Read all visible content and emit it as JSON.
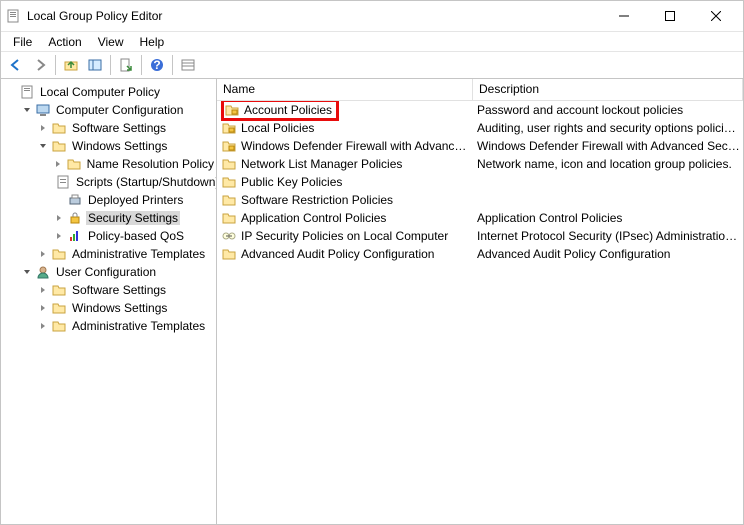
{
  "window": {
    "title": "Local Group Policy Editor"
  },
  "menu": {
    "file": "File",
    "action": "Action",
    "view": "View",
    "help": "Help"
  },
  "tree": {
    "root": "Local Computer Policy",
    "cc": "Computer Configuration",
    "cc_sw": "Software Settings",
    "cc_ws": "Windows Settings",
    "cc_ws_nrp": "Name Resolution Policy",
    "cc_ws_scripts": "Scripts (Startup/Shutdown)",
    "cc_ws_dp": "Deployed Printers",
    "cc_ws_ss": "Security Settings",
    "cc_ws_qos": "Policy-based QoS",
    "cc_at": "Administrative Templates",
    "uc": "User Configuration",
    "uc_sw": "Software Settings",
    "uc_ws": "Windows Settings",
    "uc_at": "Administrative Templates"
  },
  "columns": {
    "name": "Name",
    "description": "Description"
  },
  "rows": {
    "r0": {
      "name": "Account Policies",
      "desc": "Password and account lockout policies"
    },
    "r1": {
      "name": "Local Policies",
      "desc": "Auditing, user rights and security options polici…"
    },
    "r2": {
      "name": "Windows Defender Firewall with Advanc…",
      "desc": "Windows Defender Firewall with Advanced Sec…"
    },
    "r3": {
      "name": "Network List Manager Policies",
      "desc": "Network name, icon and location group policies."
    },
    "r4": {
      "name": "Public Key Policies",
      "desc": ""
    },
    "r5": {
      "name": "Software Restriction Policies",
      "desc": ""
    },
    "r6": {
      "name": "Application Control Policies",
      "desc": "Application Control Policies"
    },
    "r7": {
      "name": "IP Security Policies on Local Computer",
      "desc": "Internet Protocol Security (IPsec) Administratio…"
    },
    "r8": {
      "name": "Advanced Audit Policy Configuration",
      "desc": "Advanced Audit Policy Configuration"
    }
  }
}
